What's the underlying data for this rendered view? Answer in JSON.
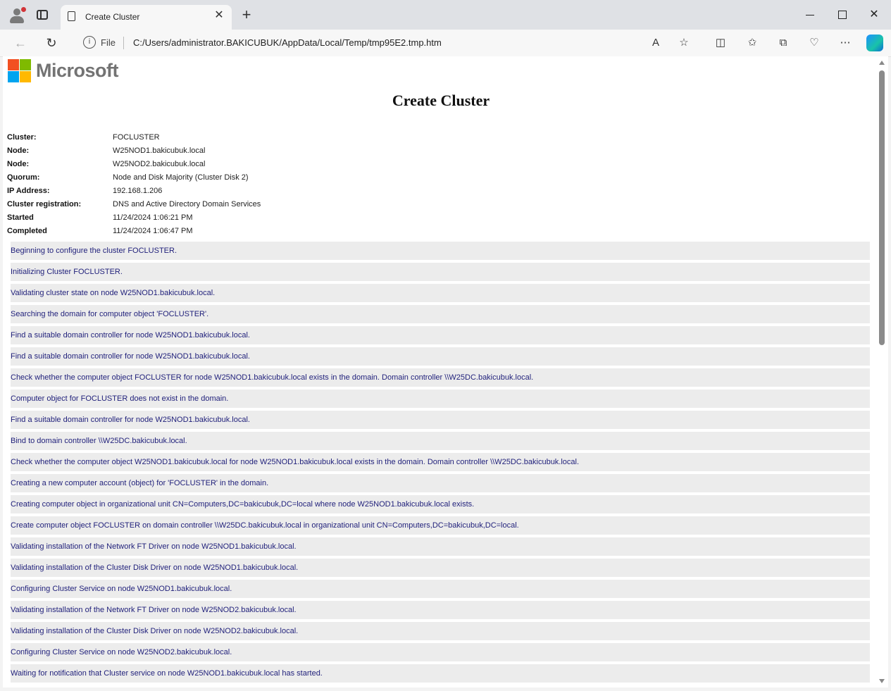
{
  "browser": {
    "tab_title": "Create Cluster",
    "address_prefix": "File",
    "url": "C:/Users/administrator.BAKICUBUK/AppData/Local/Temp/tmp95E2.tmp.htm"
  },
  "page": {
    "logo_text": "Microsoft",
    "title": "Create Cluster",
    "summary": [
      {
        "label": "Cluster:",
        "value": "FOCLUSTER"
      },
      {
        "label": "Node:",
        "value": "W25NOD1.bakicubuk.local"
      },
      {
        "label": "Node:",
        "value": "W25NOD2.bakicubuk.local"
      },
      {
        "label": "Quorum:",
        "value": "Node and Disk Majority (Cluster Disk 2)"
      },
      {
        "label": "IP Address:",
        "value": "192.168.1.206"
      },
      {
        "label": "Cluster registration:",
        "value": "DNS and Active Directory Domain Services"
      },
      {
        "label": "Started",
        "value": "11/24/2024 1:06:21 PM"
      },
      {
        "label": "Completed",
        "value": "11/24/2024 1:06:47 PM"
      }
    ],
    "log": [
      "Beginning to configure the cluster FOCLUSTER.",
      "Initializing Cluster FOCLUSTER.",
      "Validating cluster state on node W25NOD1.bakicubuk.local.",
      "Searching the domain for computer object 'FOCLUSTER'.",
      "Find a suitable domain controller for node W25NOD1.bakicubuk.local.",
      "Find a suitable domain controller for node W25NOD1.bakicubuk.local.",
      "Check whether the computer object FOCLUSTER for node W25NOD1.bakicubuk.local exists in the domain. Domain controller \\\\W25DC.bakicubuk.local.",
      "Computer object for FOCLUSTER does not exist in the domain.",
      "Find a suitable domain controller for node W25NOD1.bakicubuk.local.",
      "Bind to domain controller \\\\W25DC.bakicubuk.local.",
      "Check whether the computer object W25NOD1.bakicubuk.local for node W25NOD1.bakicubuk.local exists in the domain. Domain controller \\\\W25DC.bakicubuk.local.",
      "Creating a new computer account (object) for 'FOCLUSTER' in the domain.",
      "Creating computer object in organizational unit CN=Computers,DC=bakicubuk,DC=local where node W25NOD1.bakicubuk.local exists.",
      "Create computer object FOCLUSTER on domain controller \\\\W25DC.bakicubuk.local in organizational unit CN=Computers,DC=bakicubuk,DC=local.",
      "Validating installation of the Network FT Driver on node W25NOD1.bakicubuk.local.",
      "Validating installation of the Cluster Disk Driver on node W25NOD1.bakicubuk.local.",
      "Configuring Cluster Service on node W25NOD1.bakicubuk.local.",
      "Validating installation of the Network FT Driver on node W25NOD2.bakicubuk.local.",
      "Validating installation of the Cluster Disk Driver on node W25NOD2.bakicubuk.local.",
      "Configuring Cluster Service on node W25NOD2.bakicubuk.local.",
      "Waiting for notification that Cluster service on node W25NOD1.bakicubuk.local has started."
    ]
  }
}
